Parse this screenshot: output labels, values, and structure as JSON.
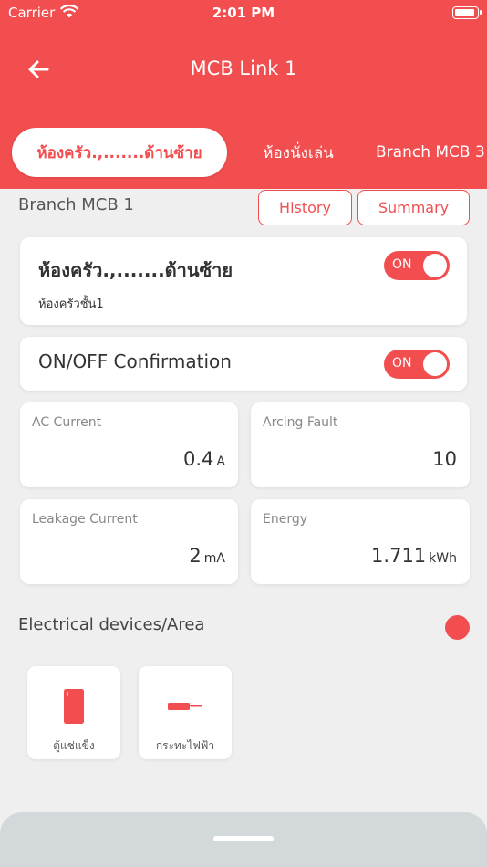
{
  "status_bar": {
    "carrier": "Carrier",
    "time": "2:01 PM"
  },
  "header": {
    "title": "MCB Link 1",
    "back_icon": "arrow-left-icon"
  },
  "tabs": [
    {
      "label": "ห้องครัว.,.......ด้านซ้าย",
      "active": true
    },
    {
      "label": "ห้องนั่งเล่น",
      "active": false
    },
    {
      "label": "Branch MCB 3",
      "active": false
    }
  ],
  "branch": {
    "label": "Branch MCB 1",
    "history_label": "History",
    "summary_label": "Summary"
  },
  "room": {
    "name": "ห้องครัว.,.......ด้านซ้าย",
    "subtitle": "ห้องครัวชั้น1",
    "toggle_label": "ON",
    "toggle_on": true
  },
  "confirmation": {
    "label": "ON/OFF Confirmation",
    "toggle_label": "ON",
    "toggle_on": true
  },
  "metrics": [
    {
      "label": "AC Current",
      "value": "0.4",
      "unit": "A"
    },
    {
      "label": "Arcing Fault",
      "value": "10",
      "unit": ""
    },
    {
      "label": "Leakage Current",
      "value": "2",
      "unit": "mA"
    },
    {
      "label": "Energy",
      "value": "1.711",
      "unit": "kWh"
    }
  ],
  "devices_section": {
    "title": "Electrical devices/Area",
    "status_color": "#f24e50"
  },
  "devices": [
    {
      "label": "ตู้แช่แข็ง",
      "icon": "refrigerator-icon"
    },
    {
      "label": "กระทะไฟฟ้า",
      "icon": "electric-pan-icon"
    }
  ],
  "colors": {
    "accent": "#f24e50",
    "background": "#efefef",
    "bottom_panel": "#d3d8db"
  }
}
